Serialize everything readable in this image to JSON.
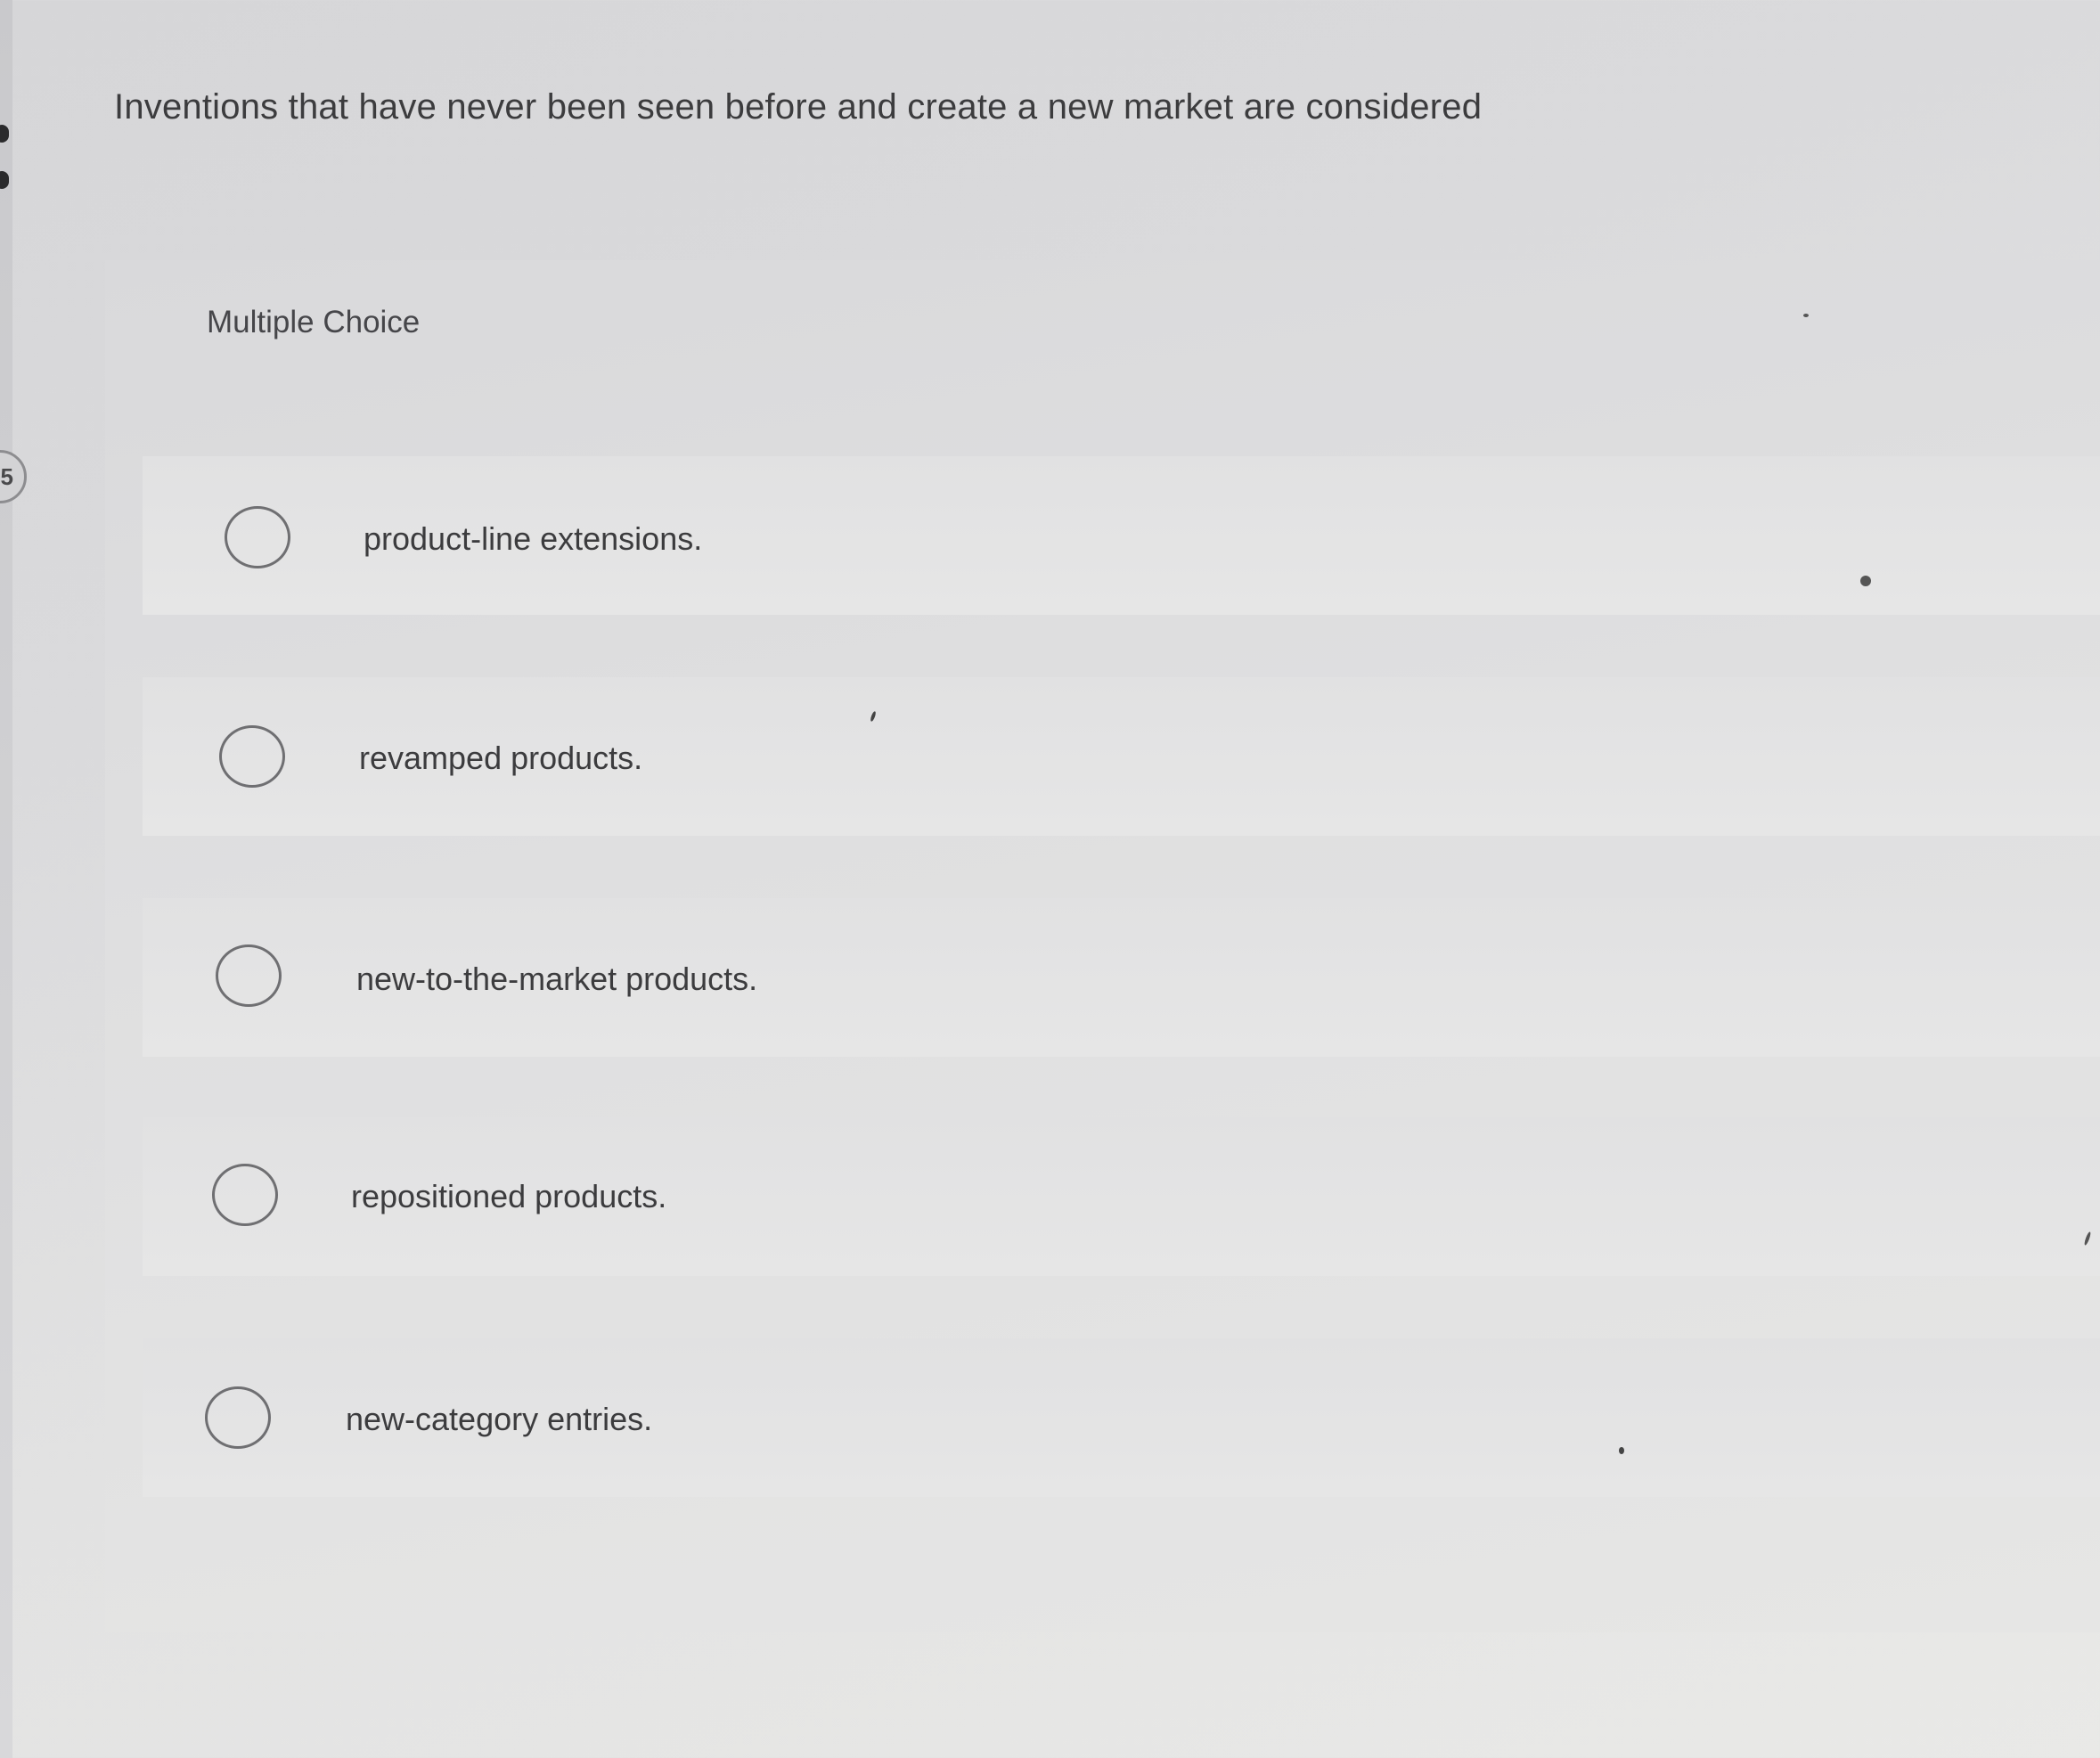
{
  "question": {
    "number": "5",
    "text": "Inventions that have never been seen before and create a new market are considered"
  },
  "answer_area": {
    "type_label": "Multiple Choice",
    "options": [
      {
        "label": "product-line extensions.",
        "selected": false
      },
      {
        "label": "revamped products.",
        "selected": false
      },
      {
        "label": "new-to-the-market products.",
        "selected": false
      },
      {
        "label": "repositioned products.",
        "selected": false
      },
      {
        "label": "new-category entries.",
        "selected": false
      }
    ]
  }
}
